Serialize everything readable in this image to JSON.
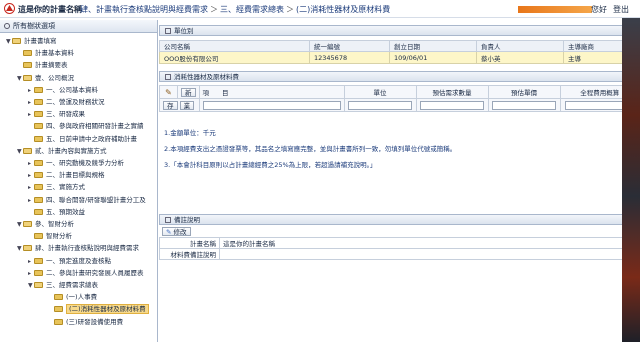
{
  "header": {
    "system_title": "這是你的計畫名稱",
    "breadcrumb": [
      "肆、計畫執行查核點說明與經費需求",
      "三、經費需求總表",
      "(二)消耗性器材及原材料費"
    ],
    "breadcrumb_sep": "＞",
    "greeting": "您好",
    "logout_label": "登出",
    "accent_color": "#e8761a"
  },
  "sidebar": {
    "title": "所有樹狀選項",
    "items": [
      {
        "label": "計畫書填寫",
        "level": 0,
        "toggle": "▼",
        "icon": "folder-open-icon"
      },
      {
        "label": "計畫基本資料",
        "level": 1,
        "toggle": "",
        "icon": "folder-icon"
      },
      {
        "label": "計畫摘要表",
        "level": 1,
        "toggle": "",
        "icon": "folder-icon"
      },
      {
        "label": "壹、公司概況",
        "level": 1,
        "toggle": "▼",
        "icon": "folder-open-icon"
      },
      {
        "label": "一、公司基本資料",
        "level": 2,
        "toggle": "▸",
        "icon": "folder-icon"
      },
      {
        "label": "二、營運及財務狀況",
        "level": 2,
        "toggle": "▸",
        "icon": "folder-icon"
      },
      {
        "label": "三、研發成果",
        "level": 2,
        "toggle": "▸",
        "icon": "folder-icon"
      },
      {
        "label": "四、參與政府相關研發計畫之實績",
        "level": 2,
        "toggle": "",
        "icon": "folder-icon"
      },
      {
        "label": "五、日前申請中之政府補助計畫",
        "level": 2,
        "toggle": "",
        "icon": "folder-icon"
      },
      {
        "label": "貳、計畫內容與實施方式",
        "level": 1,
        "toggle": "▼",
        "icon": "folder-open-icon"
      },
      {
        "label": "一、研究動機及競爭力分析",
        "level": 2,
        "toggle": "▸",
        "icon": "folder-icon"
      },
      {
        "label": "二、計畫目標與規格",
        "level": 2,
        "toggle": "▸",
        "icon": "folder-icon"
      },
      {
        "label": "三、實施方式",
        "level": 2,
        "toggle": "▸",
        "icon": "folder-icon"
      },
      {
        "label": "四、聯合開發/研發聯盟計畫分工及",
        "level": 2,
        "toggle": "▸",
        "icon": "folder-icon"
      },
      {
        "label": "五、預期效益",
        "level": 2,
        "toggle": "",
        "icon": "folder-icon"
      },
      {
        "label": "參、智財分析",
        "level": 1,
        "toggle": "▼",
        "icon": "folder-open-icon"
      },
      {
        "label": "智財分析",
        "level": 2,
        "toggle": "",
        "icon": "folder-icon"
      },
      {
        "label": "肆、計畫執行查核點說明與經費需求",
        "level": 1,
        "toggle": "▼",
        "icon": "folder-open-icon"
      },
      {
        "label": "一、預定進度及查核點",
        "level": 2,
        "toggle": "▸",
        "icon": "folder-icon"
      },
      {
        "label": "二、參與計畫研究發展人員履歷表",
        "level": 2,
        "toggle": "▸",
        "icon": "folder-icon"
      },
      {
        "label": "三、經費需求總表",
        "level": 2,
        "toggle": "▼",
        "icon": "folder-open-icon"
      },
      {
        "label": "(一)人事費",
        "level": 3,
        "toggle": "",
        "icon": "folder-icon"
      },
      {
        "label": "(二)消耗性器材及原材料費",
        "level": 3,
        "toggle": "",
        "icon": "folder-icon",
        "selected": true
      },
      {
        "label": "(三)研發設備使用費",
        "level": 3,
        "toggle": "",
        "icon": "folder-icon"
      }
    ]
  },
  "unit_panel": {
    "title": "單位別",
    "columns": [
      "公司名稱",
      "統一編號",
      "創立日期",
      "負責人",
      "主導廠商"
    ],
    "row": [
      "OOO股份有限公司",
      "12345678",
      "109/06/01",
      "蔡小英",
      "主導"
    ]
  },
  "consumables_panel": {
    "title": "消耗性器材及原材料費",
    "new_label": "新",
    "save_label": "存",
    "cancel_label": "業",
    "columns": [
      "項　　目",
      "單位",
      "預估需求數量",
      "預估單價",
      "全程費用概算"
    ]
  },
  "notes": {
    "line1": "1.金額單位：千元",
    "line2": "2.本項經費支出之憑證發票等，其品名之填寫應完整，並與計畫書所列一致，勿填列單位代號或簡稱。",
    "line3": "3.「本會計科目原則以占計畫總經費之25%為上限，若超過請補充說明。」"
  },
  "remark_panel": {
    "title": "備註說明",
    "edit_label": "修改",
    "plan_label": "計畫名稱",
    "plan_value": "這是你的計畫名稱",
    "remark_label": "材料費備註說明"
  }
}
